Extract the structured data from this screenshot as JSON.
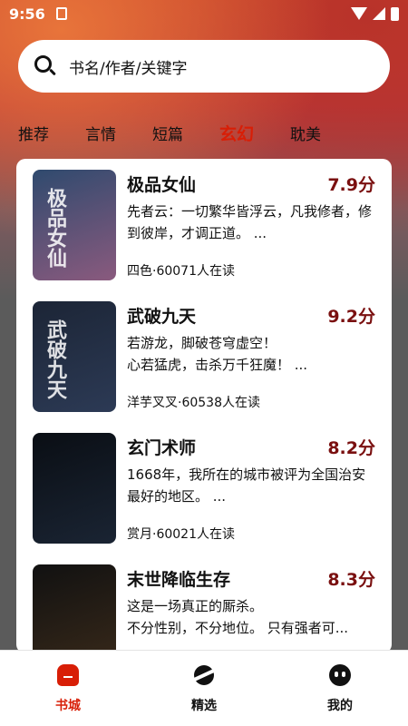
{
  "status_bar": {
    "time": "9:56"
  },
  "search": {
    "placeholder": "书名/作者/关键字",
    "icon": "search-icon"
  },
  "tabs": [
    {
      "label": "推荐",
      "active": false
    },
    {
      "label": "言情",
      "active": false
    },
    {
      "label": "短篇",
      "active": false
    },
    {
      "label": "玄幻",
      "active": true
    },
    {
      "label": "耽美",
      "active": false
    }
  ],
  "books": [
    {
      "title": "极品女仙",
      "score": "7.9分",
      "desc": "先者云：一切繁华皆浮云，凡我修者，修到彼岸，才调正道。 ...",
      "meta": "四色·60071人在读",
      "cover_text": "极品女仙",
      "cover_colors": [
        "#2f4a6e",
        "#8a5a7e"
      ]
    },
    {
      "title": "武破九天",
      "score": "9.2分",
      "desc": "若游龙，脚破苍穹虚空！\n心若猛虎，击杀万千狂魔！ ...",
      "meta": "洋芋叉叉·60538人在读",
      "cover_text": "武破九天",
      "cover_colors": [
        "#1c2536",
        "#2c3a55"
      ]
    },
    {
      "title": "玄门术师",
      "score": "8.2分",
      "desc": "1668年，我所在的城市被评为全国治安最好的地区。 ...",
      "meta": "赏月·60021人在读",
      "cover_text": "",
      "cover_colors": [
        "#0a0e14",
        "#1a2433"
      ]
    },
    {
      "title": "末世降临生存",
      "score": "8.3分",
      "desc": "这是一场真正的厮杀。\n不分性别，不分地位。 只有强者可...",
      "meta": "",
      "cover_text": "",
      "cover_colors": [
        "#111111",
        "#3a2a1a"
      ]
    }
  ],
  "bottom_nav": [
    {
      "label": "书城",
      "icon": "home-icon",
      "active": true
    },
    {
      "label": "精选",
      "icon": "planet-icon",
      "active": false
    },
    {
      "label": "我的",
      "icon": "profile-icon",
      "active": false
    }
  ],
  "colors": {
    "accent": "#d81e06",
    "score": "#7a1010"
  }
}
